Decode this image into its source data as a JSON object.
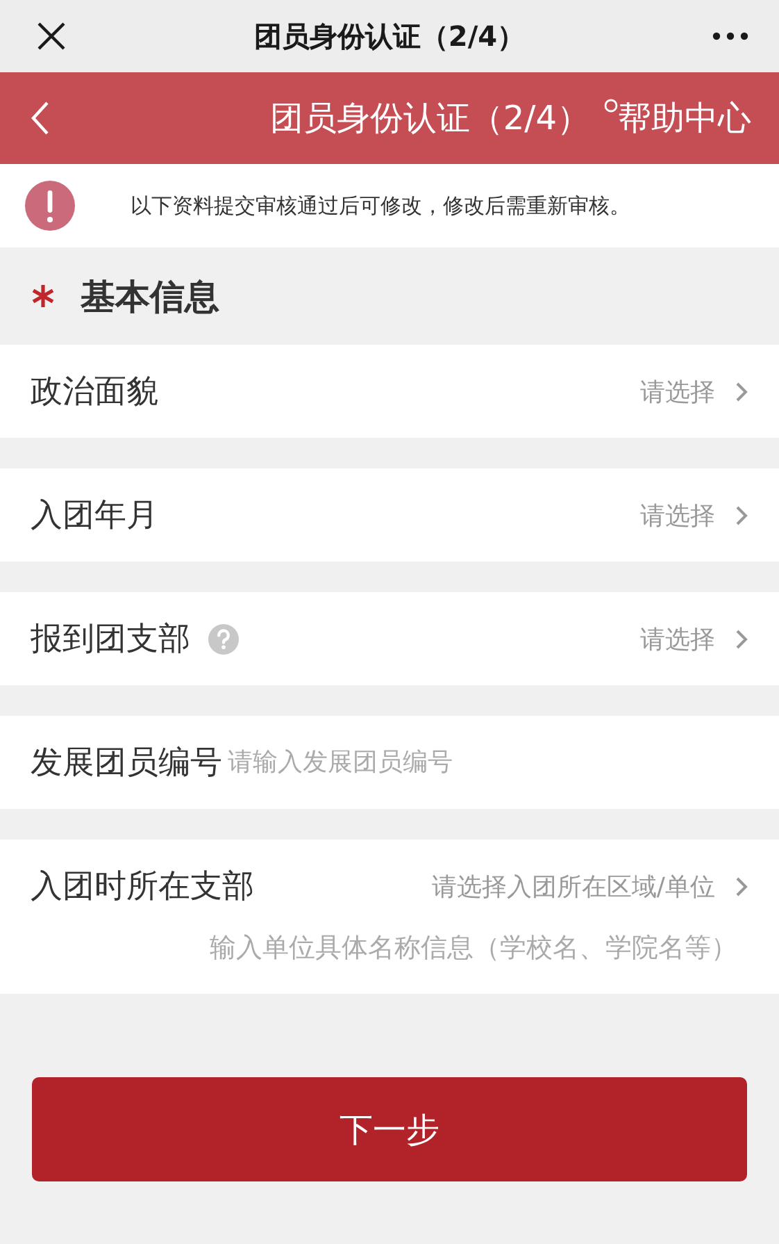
{
  "top_bar": {
    "title": "团员身份认证（2/4）"
  },
  "header": {
    "title": "团员身份认证（2/4）",
    "link": "帮助中心"
  },
  "notice": {
    "text": "以下资料提交审核通过后可修改，修改后需重新审核。"
  },
  "section": {
    "required": true,
    "title": "基本信息"
  },
  "fields": [
    {
      "kind": "select",
      "label": "政治面貌",
      "value": "请选择",
      "help": false
    },
    {
      "kind": "select",
      "label": "入团年月",
      "value": "请选择",
      "help": false
    },
    {
      "kind": "select",
      "label": "报到团支部",
      "value": "请选择",
      "help": true
    },
    {
      "kind": "input",
      "label": "发展团员编号",
      "placeholder": "请输入发展团员编号"
    },
    {
      "kind": "compound",
      "label": "入团时所在支部",
      "value": "请选择入团所在区域/单位",
      "placeholder": "输入单位具体名称信息（学校名、学院名等）"
    }
  ],
  "next_button": {
    "label": "下一步"
  }
}
